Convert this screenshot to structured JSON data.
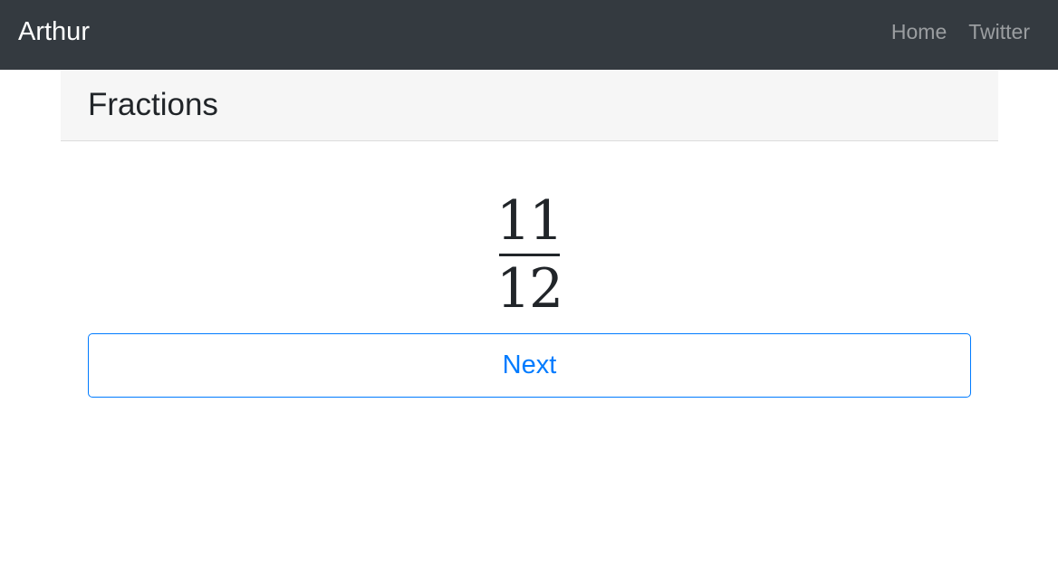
{
  "navbar": {
    "brand": "Arthur",
    "links": [
      {
        "label": "Home"
      },
      {
        "label": "Twitter"
      }
    ]
  },
  "card": {
    "title": "Fractions"
  },
  "fraction": {
    "numerator": "11",
    "denominator": "12"
  },
  "actions": {
    "next_label": "Next"
  },
  "colors": {
    "navbar_bg": "#343a40",
    "primary": "#007bff",
    "header_bg": "#f6f6f6"
  }
}
